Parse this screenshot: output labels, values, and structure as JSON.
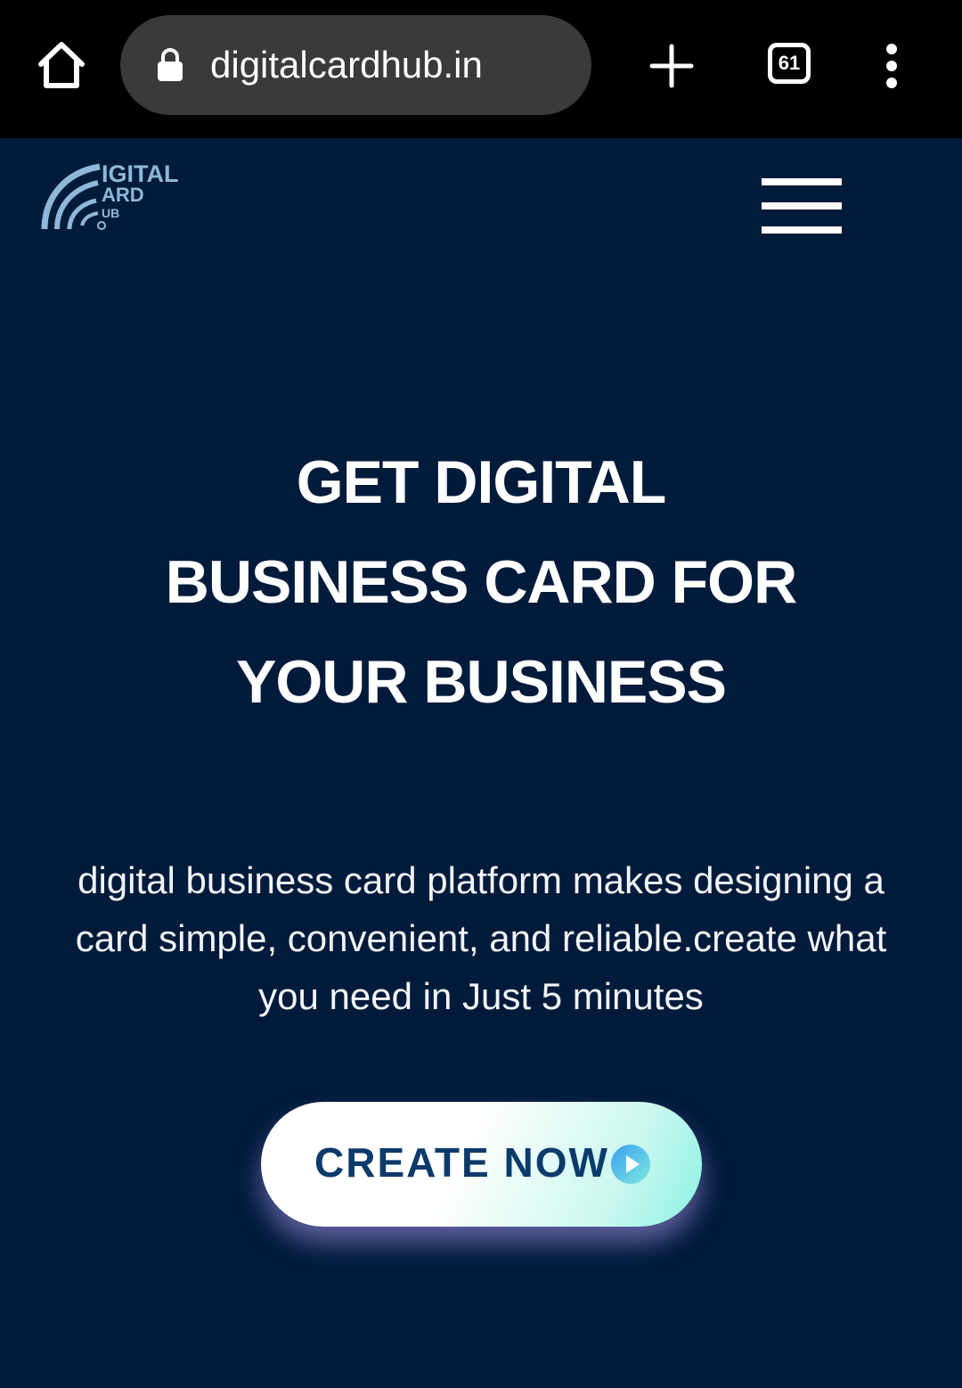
{
  "browser": {
    "url": "digitalcardhub.in",
    "tab_count": "61",
    "icons": [
      "home-icon",
      "lock-icon",
      "plus-icon",
      "tab-switcher-icon",
      "more-vert-icon"
    ]
  },
  "header": {
    "logo_text": {
      "line1": "IGITAL",
      "line2": "ARD",
      "line3": "UB"
    },
    "menu_icon": "hamburger-icon"
  },
  "hero": {
    "title_lines": [
      "GET DIGITAL",
      "BUSINESS CARD FOR",
      "YOUR BUSINESS"
    ],
    "description": "digital business card platform makes designing a card simple, convenient, and reliable.create what you need in Just 5 minutes",
    "cta_label": "CREATE NOW",
    "cta_icon": "play-circle-icon"
  },
  "colors": {
    "background": "#021b3b",
    "browser_bar": "#000000",
    "url_box": "#3a3a3a",
    "logo": "#8fb8d8",
    "cta_text": "#0c3a6a",
    "cta_gradient_end": "#8cf2e4",
    "cta_icon_start": "#3aa0f0",
    "cta_icon_end": "#7de8e0"
  }
}
